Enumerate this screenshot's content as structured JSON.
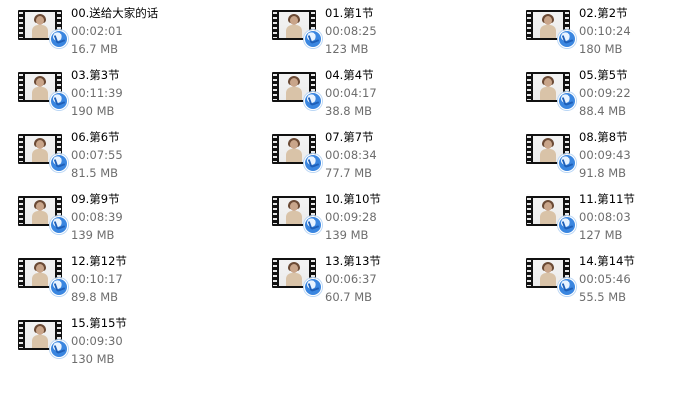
{
  "files": [
    {
      "name": "00.送给大家的话",
      "duration": "00:02:01",
      "size": "16.7 MB",
      "icon": "video-file-icon"
    },
    {
      "name": "01.第1节",
      "duration": "00:08:25",
      "size": "123 MB",
      "icon": "video-file-icon"
    },
    {
      "name": "02.第2节",
      "duration": "00:10:24",
      "size": "180 MB",
      "icon": "video-file-icon"
    },
    {
      "name": "03.第3节",
      "duration": "00:11:39",
      "size": "190 MB",
      "icon": "video-file-icon"
    },
    {
      "name": "04.第4节",
      "duration": "00:04:17",
      "size": "38.8 MB",
      "icon": "video-file-icon"
    },
    {
      "name": "05.第5节",
      "duration": "00:09:22",
      "size": "88.4 MB",
      "icon": "video-file-icon"
    },
    {
      "name": "06.第6节",
      "duration": "00:07:55",
      "size": "81.5 MB",
      "icon": "video-file-icon"
    },
    {
      "name": "07.第7节",
      "duration": "00:08:34",
      "size": "77.7 MB",
      "icon": "video-file-icon"
    },
    {
      "name": "08.第8节",
      "duration": "00:09:43",
      "size": "91.8 MB",
      "icon": "video-file-icon"
    },
    {
      "name": "09.第9节",
      "duration": "00:08:39",
      "size": "139 MB",
      "icon": "video-file-icon"
    },
    {
      "name": "10.第10节",
      "duration": "00:09:28",
      "size": "139 MB",
      "icon": "video-file-icon"
    },
    {
      "name": "11.第11节",
      "duration": "00:08:03",
      "size": "127 MB",
      "icon": "video-file-icon"
    },
    {
      "name": "12.第12节",
      "duration": "00:10:17",
      "size": "89.8 MB",
      "icon": "video-file-icon"
    },
    {
      "name": "13.第13节",
      "duration": "00:06:37",
      "size": "60.7 MB",
      "icon": "video-file-icon"
    },
    {
      "name": "14.第14节",
      "duration": "00:05:46",
      "size": "55.5 MB",
      "icon": "video-file-icon"
    },
    {
      "name": "15.第15节",
      "duration": "00:09:30",
      "size": "130 MB",
      "icon": "video-file-icon"
    }
  ],
  "colors": {
    "background": "#ffffff",
    "name_text": "#000000",
    "detail_text": "#6d6d6d",
    "badge_blue": "#3a86e0"
  }
}
